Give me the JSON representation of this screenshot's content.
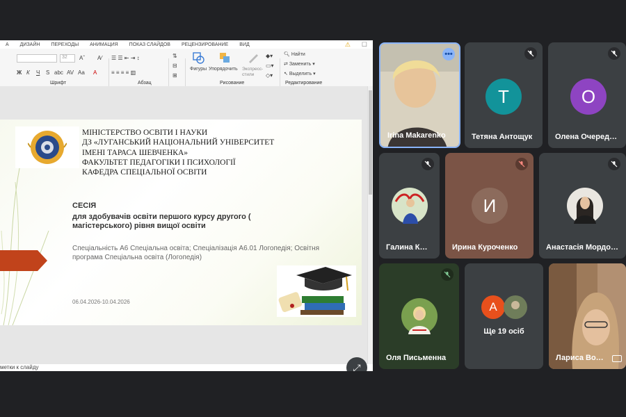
{
  "powerpoint": {
    "menu": [
      "А",
      "ДИЗАЙН",
      "ПЕРЕХОДЫ",
      "АНИМАЦИЯ",
      "ПОКАЗ СЛАЙДОВ",
      "РЕЦЕНЗИРОВАНИЕ",
      "ВИД"
    ],
    "font_size": "32",
    "groups": {
      "font": "Шрифт",
      "paragraph": "Абзац",
      "drawing": "Рисование",
      "editing": "Редактирование"
    },
    "drawing_tools": {
      "shapes": "Фигуры",
      "arrange": "Упорядочить",
      "quick_styles": "Экспресс-стили"
    },
    "editing_tools": {
      "find": "Найти",
      "replace": "Заменить",
      "select": "Выделить"
    },
    "status_notes": "метки к слайду"
  },
  "slide": {
    "header_lines": [
      "МІНІСТЕРСТВО ОСВІТИ І НАУКИ",
      "ДЗ «ЛУГАНСЬКИЙ НАЦІОНАЛЬНИЙ УНІВЕРСИТЕТ",
      "ІМЕНІ ТАРАСА ШЕВЧЕНКА»",
      "ФАКУЛЬТЕТ ПЕДАГОГІКИ І ПСИХОЛОГІЇ",
      "КАФЕДРА СПЕЦІАЛЬНОЇ ОСВІТИ"
    ],
    "session_title": "СЕСІЯ",
    "session_subtitle": "для здобувачів освіти першого курсу другого ( магістерського) рівня вищої освіти",
    "specialty": "Спеціальність А6 Спеціальна освіта; Спеціалізація А6.01 Логопедія; Освітня програма Спеціальна освіта (Логопедія)",
    "dates": "06.04.2026-10.04.2026"
  },
  "participants": [
    {
      "name": "Irina Makarenko",
      "initial": "",
      "color": "#7a6a5a"
    },
    {
      "name": "Тетяна Антощук",
      "initial": "Т",
      "color": "#12939a"
    },
    {
      "name": "Олена Очеред…",
      "initial": "О",
      "color": "#8e44c2"
    },
    {
      "name": "Галина К…",
      "initial": "",
      "color": "#5a5a5a"
    },
    {
      "name": "Ирина Куроченко",
      "initial": "И",
      "color": "#8c6b5c"
    },
    {
      "name": "Анастасія Мордо…",
      "initial": "",
      "color": "#5a5a5a"
    },
    {
      "name": "Оля Письменна",
      "initial": "",
      "color": "#2f4a2c"
    },
    {
      "name": "Ще 19 осіб",
      "initial": "А",
      "color": "#e8501c"
    },
    {
      "name": "Лариса Во…",
      "initial": "",
      "color": "#6b5540"
    }
  ]
}
